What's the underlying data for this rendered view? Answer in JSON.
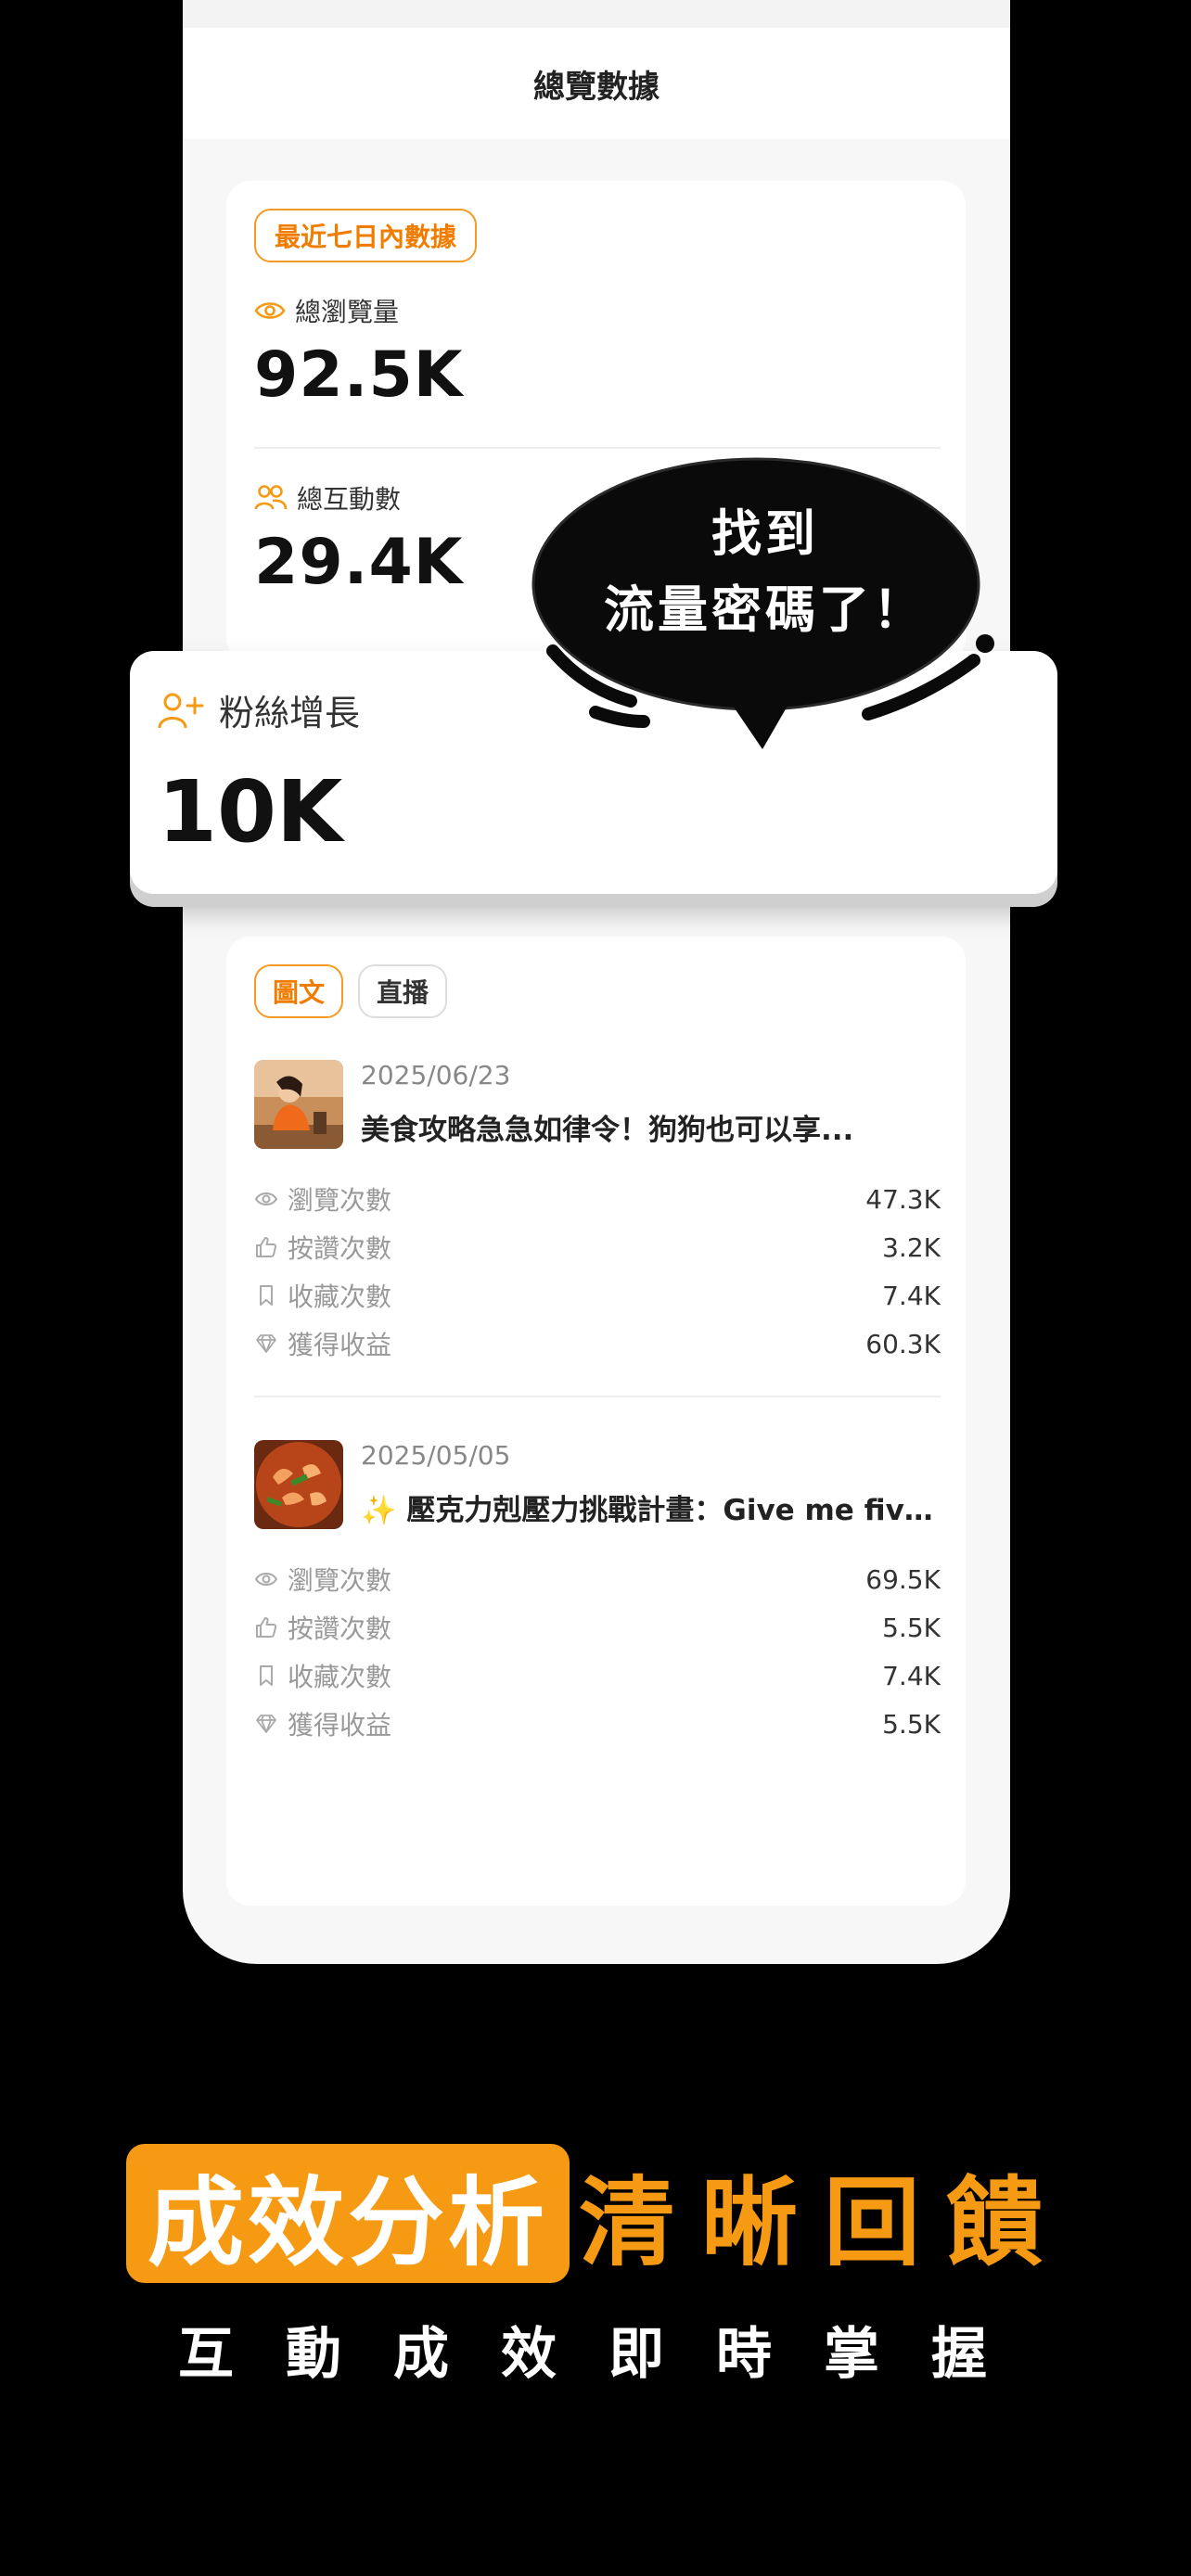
{
  "header": {
    "title": "總覽數據"
  },
  "overview": {
    "period_tag": "最近七日內數據",
    "metrics": [
      {
        "label": "總瀏覽量",
        "value": "92.5K",
        "icon": "eye-icon"
      },
      {
        "label": "總互動數",
        "value": "29.4K",
        "icon": "users-icon"
      }
    ]
  },
  "highlight": {
    "label": "粉絲增長",
    "value": "10K",
    "icon": "user-plus-icon"
  },
  "bubble": {
    "line1": "找到",
    "line2": "流量密碼了！"
  },
  "content": {
    "tabs": [
      {
        "label": "圖文",
        "active": true
      },
      {
        "label": "直播",
        "active": false
      }
    ],
    "stat_labels": {
      "views": "瀏覽次數",
      "likes": "按讚次數",
      "saves": "收藏次數",
      "earnings": "獲得收益"
    },
    "posts": [
      {
        "date": "2025/06/23",
        "title": "美食攻略急急如律令！狗狗也可以享...",
        "views": "47.3K",
        "likes": "3.2K",
        "saves": "7.4K",
        "earnings": "60.3K"
      },
      {
        "date": "2025/05/05",
        "title": "✨ 壓克力剋壓力挑戰計畫：Give me five!",
        "views": "69.5K",
        "likes": "5.5K",
        "saves": "7.4K",
        "earnings": "5.5K"
      }
    ]
  },
  "promo": {
    "highlight": "成效分析",
    "rest": "清晰回饋",
    "subtitle": "互動成效即時掌握"
  },
  "colors": {
    "accent": "#f59a12",
    "background": "#000000"
  }
}
